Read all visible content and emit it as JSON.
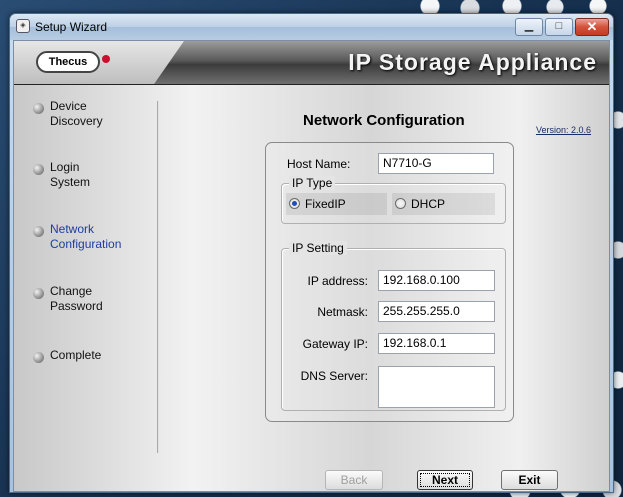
{
  "window": {
    "title": "Setup Wizard",
    "minimize_icon": "minimize-icon",
    "maximize_icon": "maximize-icon",
    "close_icon": "close-icon"
  },
  "banner": {
    "logo_text": "Thecus",
    "title": "IP Storage Appliance"
  },
  "sidebar": {
    "items": [
      {
        "label": "Device\nDiscovery",
        "active": false
      },
      {
        "label": "Login\nSystem",
        "active": false
      },
      {
        "label": "Network\nConfiguration",
        "active": true
      },
      {
        "label": "Change\nPassword",
        "active": false
      },
      {
        "label": "Complete",
        "active": false
      }
    ]
  },
  "main": {
    "title": "Network Configuration",
    "version": "Version: 2.0.6",
    "host_name_label": "Host Name:",
    "host_name_value": "N7710-G",
    "ip_type": {
      "legend": "IP Type",
      "options": [
        {
          "label": "FixedIP",
          "checked": true
        },
        {
          "label": "DHCP",
          "checked": false
        }
      ]
    },
    "ip_setting": {
      "legend": "IP Setting",
      "ip_address_label": "IP address:",
      "ip_address_value": "192.168.0.100",
      "netmask_label": "Netmask:",
      "netmask_value": "255.255.255.0",
      "gateway_label": "Gateway IP:",
      "gateway_value": "192.168.0.1",
      "dns_label": "DNS Server:",
      "dns_value": ""
    }
  },
  "buttons": {
    "back": "Back",
    "next": "Next",
    "exit": "Exit"
  },
  "colors": {
    "active_nav": "#1a3fa0",
    "close_button": "#d4523b"
  }
}
